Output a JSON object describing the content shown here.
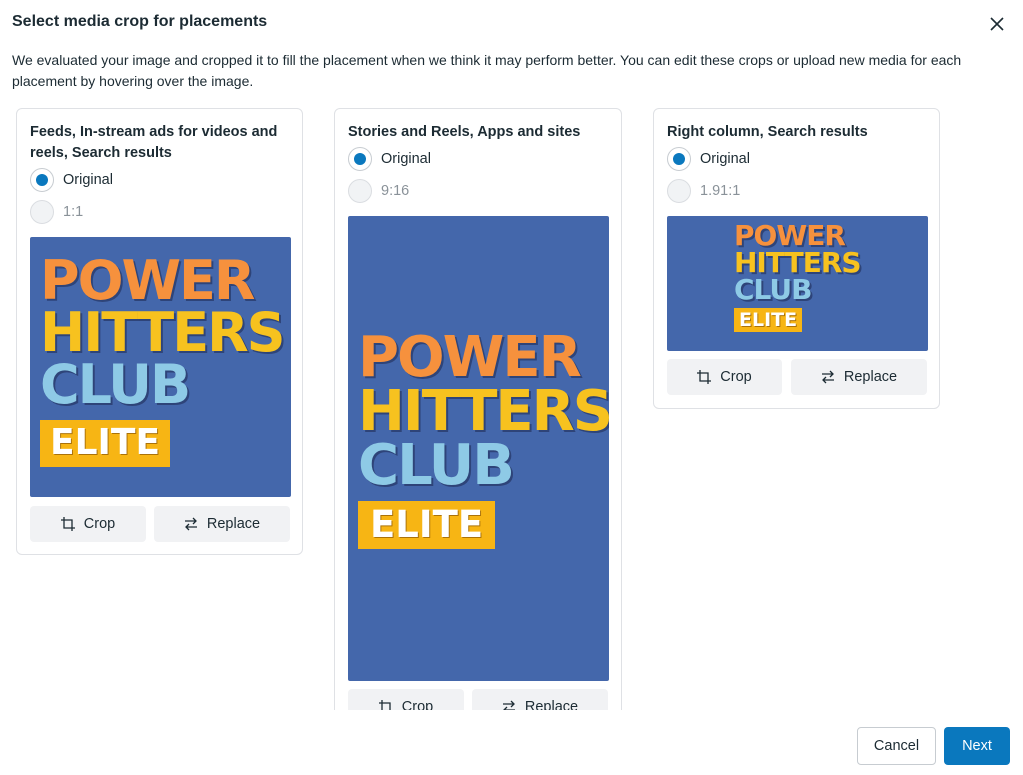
{
  "dialog": {
    "title": "Select media crop for placements",
    "description": "We evaluated your image and cropped it to fill the placement when we think it may perform better. You can edit these crops or upload new media for each placement by hovering over the image."
  },
  "placements": [
    {
      "title": "Feeds, In-stream ads for videos and reels, Search results",
      "options": [
        {
          "label": "Original",
          "selected": true
        },
        {
          "label": "1:1",
          "selected": false
        }
      ],
      "crop_label": "Crop",
      "replace_label": "Replace"
    },
    {
      "title": "Stories and Reels, Apps and sites",
      "options": [
        {
          "label": "Original",
          "selected": true
        },
        {
          "label": "9:16",
          "selected": false
        }
      ],
      "crop_label": "Crop",
      "replace_label": "Replace"
    },
    {
      "title": "Right column, Search results",
      "options": [
        {
          "label": "Original",
          "selected": true
        },
        {
          "label": "1.91:1",
          "selected": false
        }
      ],
      "crop_label": "Crop",
      "replace_label": "Replace"
    }
  ],
  "artwork": {
    "line1": "POWER",
    "line2": "HITTERS",
    "line3": "CLUB",
    "badge": "ELITE"
  },
  "footer": {
    "cancel_label": "Cancel",
    "next_label": "Next"
  },
  "colors": {
    "accent": "#0a78be",
    "media_bg": "#4467ab",
    "art_orange": "#f6913d",
    "art_yellow": "#f7c21f",
    "art_blue": "#8ecae6"
  }
}
